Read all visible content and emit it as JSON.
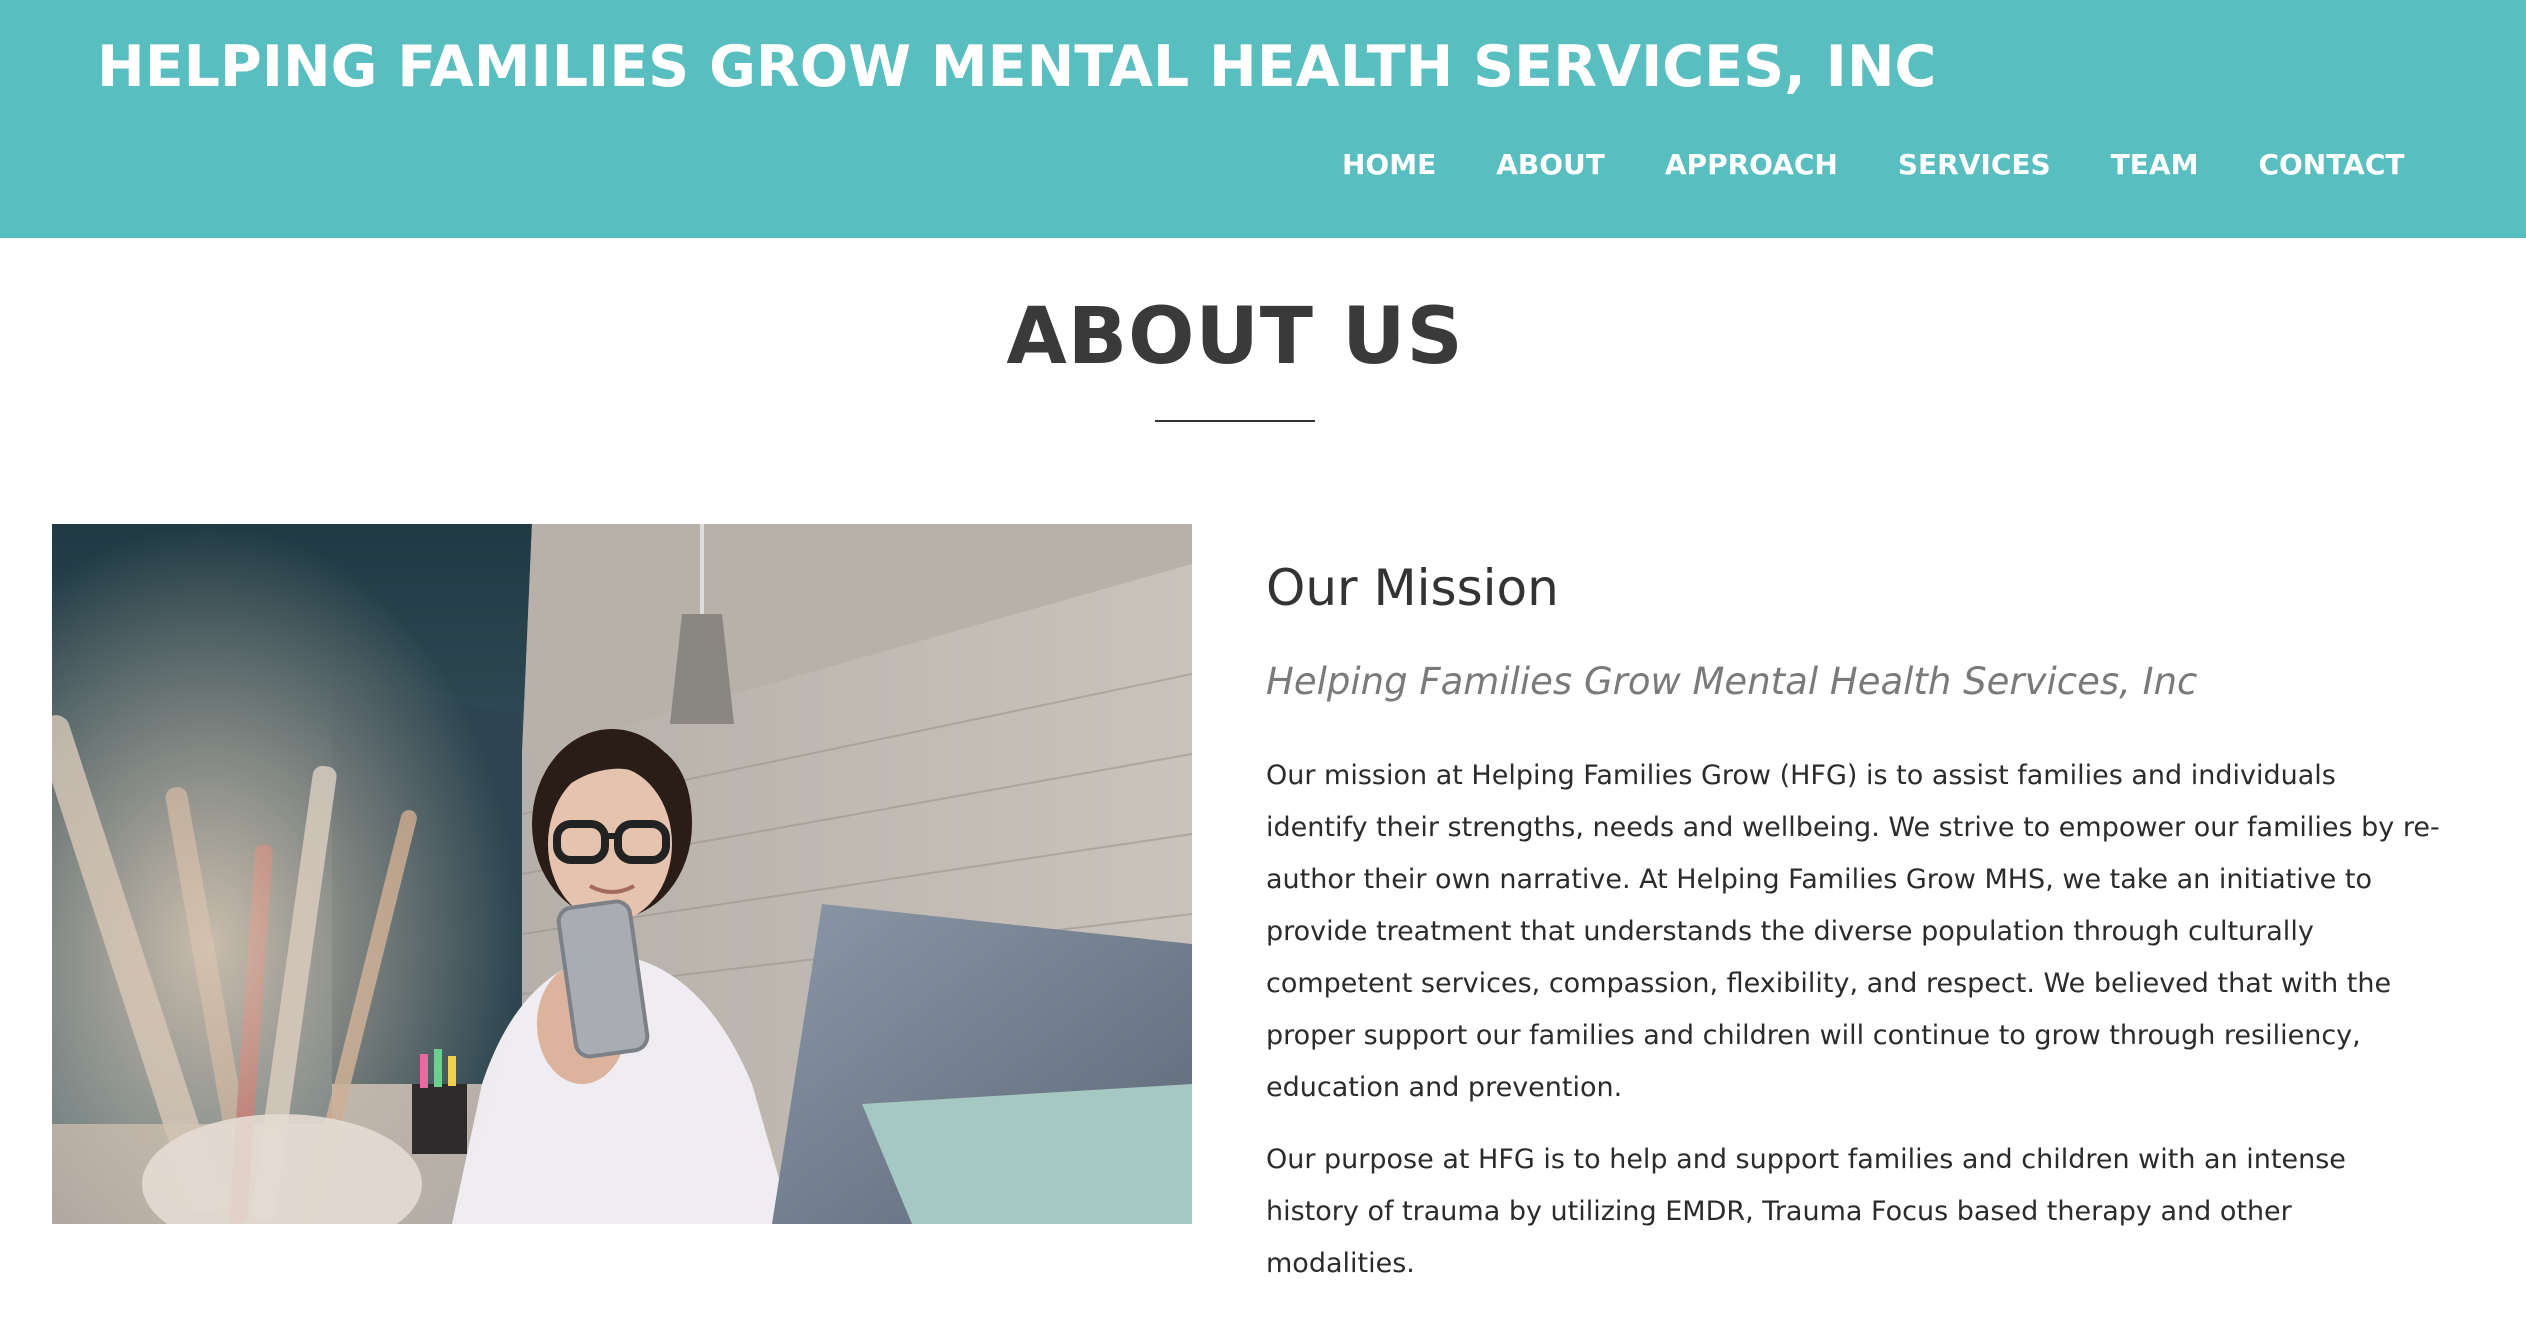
{
  "header": {
    "site_title": "HELPING FAMILIES GROW MENTAL HEALTH SERVICES, INC",
    "background_color": "#58bec0",
    "nav": [
      "HOME",
      "ABOUT",
      "APPROACH",
      "SERVICES",
      "TEAM",
      "CONTACT"
    ]
  },
  "main": {
    "heading": "ABOUT US",
    "image": {
      "icon": "photo-woman-with-phone-and-laptop"
    },
    "mission": {
      "title": "Our Mission",
      "subtitle": "Helping Families Grow Mental Health Services, Inc",
      "paragraphs": [
        "Our mission at Helping Families Grow (HFG) is to assist families and individuals identify their strengths, needs and wellbeing. We strive to empower our families by re-author their own narrative. At Helping Families Grow MHS, we take an initiative to provide treatment that understands the diverse population through culturally competent services, compassion, flexibility, and respect. We believed that with the proper support our families and children will continue to grow through resiliency, education and prevention.",
        "Our purpose at HFG is to help and support families and children with an intense history of trauma by utilizing EMDR, Trauma Focus based therapy and other modalities."
      ]
    }
  }
}
